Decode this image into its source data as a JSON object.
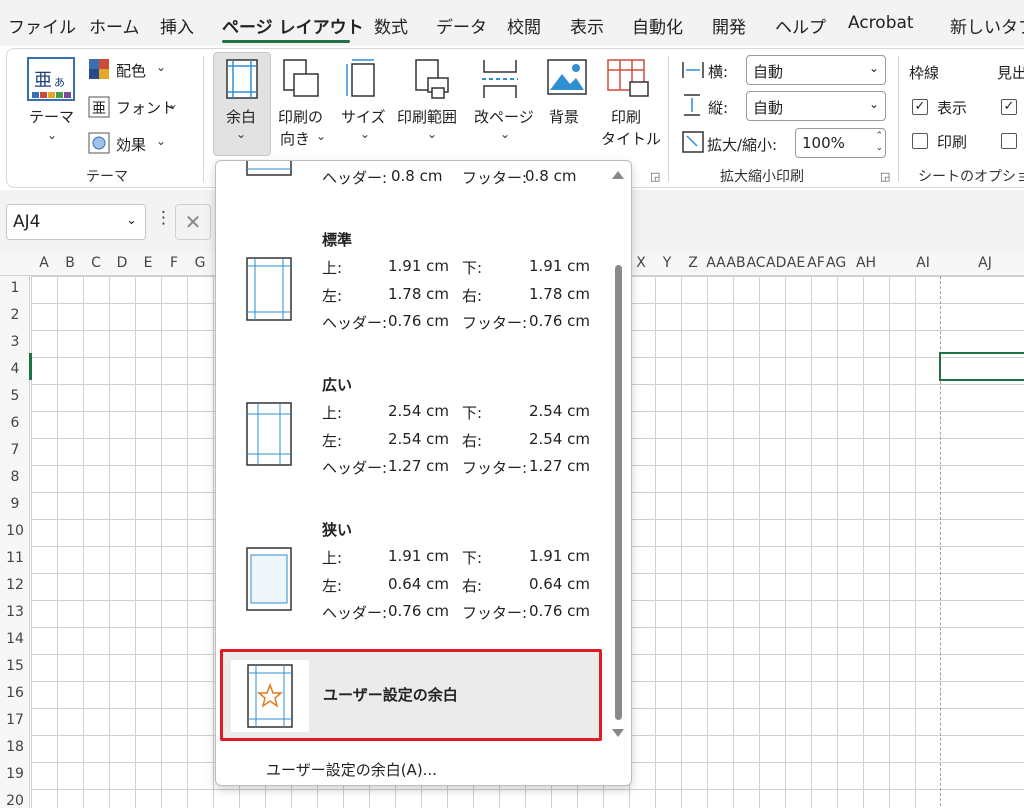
{
  "menubar": {
    "items": [
      "ファイル",
      "ホーム",
      "挿入",
      "ページ レイアウト",
      "数式",
      "データ",
      "校閲",
      "表示",
      "自動化",
      "開発",
      "ヘルプ",
      "Acrobat",
      "新しいタブ"
    ],
    "active_index": 3,
    "accent_color": "#1e7145"
  },
  "ribbon": {
    "theme_group": {
      "theme_label": "テーマ",
      "colors_label": "配色",
      "fonts_label": "フォント",
      "effects_label": "効果",
      "group_label": "テーマ"
    },
    "page_setup": {
      "margins_label": "余白",
      "orientation_label_1": "印刷の",
      "orientation_label_2": "向き",
      "size_label": "サイズ",
      "print_area_label": "印刷範囲",
      "breaks_label": "改ページ",
      "background_label": "背景",
      "print_titles_label_1": "印刷",
      "print_titles_label_2": "タイトル"
    },
    "scale_to_fit": {
      "width_label": "横:",
      "width_value": "自動",
      "height_label": "縦:",
      "height_value": "自動",
      "scale_label": "拡大/縮小:",
      "scale_value": "100%",
      "group_label": "拡大縮小印刷"
    },
    "sheet_options": {
      "gridlines_label": "枠線",
      "view_label": "表示",
      "print_label": "印刷",
      "headings_label": "見出",
      "group_label": "シートのオプション",
      "gridlines_view_checked": true,
      "gridlines_print_checked": false
    }
  },
  "formula_bar": {
    "name_box_value": "AJ4"
  },
  "sheet": {
    "columns": [
      "A",
      "B",
      "C",
      "D",
      "E",
      "F",
      "G",
      "X",
      "Y",
      "Z",
      "AA",
      "AB",
      "AC",
      "AD",
      "AE",
      "AF",
      "AG",
      "AH",
      "AI",
      "AJ"
    ],
    "rows": [
      "1",
      "2",
      "3",
      "4",
      "5",
      "6",
      "7",
      "8",
      "9",
      "10",
      "11",
      "12",
      "13",
      "14",
      "15",
      "16",
      "17",
      "18",
      "19",
      "20"
    ],
    "active_cell": "AJ4"
  },
  "margins_dropdown": {
    "partial_top": {
      "header_label": "ヘッダー:",
      "header_value": "0.8 cm",
      "footer_label": "フッター:",
      "footer_value": "0.8 cm"
    },
    "options": [
      {
        "title": "標準",
        "top_label": "上:",
        "top": "1.91 cm",
        "bottom_label": "下:",
        "bottom": "1.91 cm",
        "left_label": "左:",
        "left": "1.78 cm",
        "right_label": "右:",
        "right": "1.78 cm",
        "header_label": "ヘッダー:",
        "header": "0.76 cm",
        "footer_label": "フッター:",
        "footer": "0.76 cm"
      },
      {
        "title": "広い",
        "top_label": "上:",
        "top": "2.54 cm",
        "bottom_label": "下:",
        "bottom": "2.54 cm",
        "left_label": "左:",
        "left": "2.54 cm",
        "right_label": "右:",
        "right": "2.54 cm",
        "header_label": "ヘッダー:",
        "header": "1.27 cm",
        "footer_label": "フッター:",
        "footer": "1.27 cm"
      },
      {
        "title": "狭い",
        "top_label": "上:",
        "top": "1.91 cm",
        "bottom_label": "下:",
        "bottom": "1.91 cm",
        "left_label": "左:",
        "left": "0.64 cm",
        "right_label": "右:",
        "right": "0.64 cm",
        "header_label": "ヘッダー:",
        "header": "0.76 cm",
        "footer_label": "フッター:",
        "footer": "0.76 cm"
      }
    ],
    "custom_label": "ユーザー設定の余白",
    "custom_menu_item": "ユーザー設定の余白(A)...",
    "highlight_color": "#e01b24"
  }
}
